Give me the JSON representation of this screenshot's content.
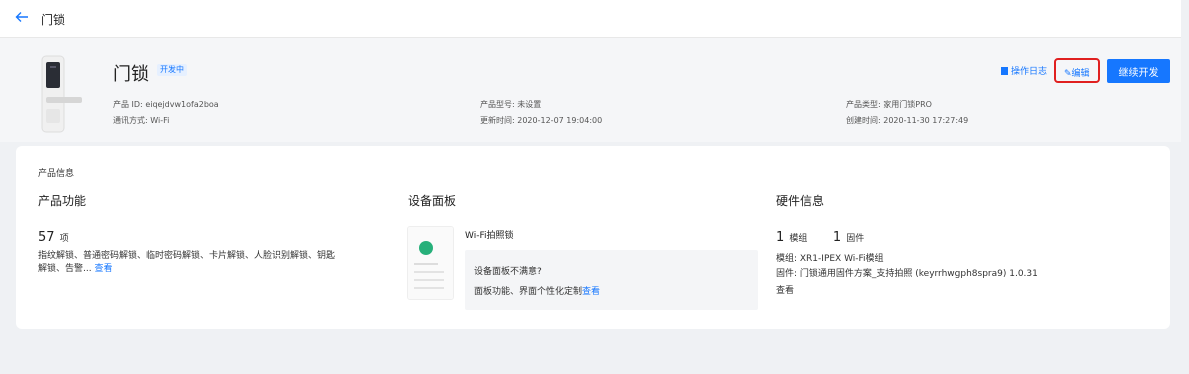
{
  "topbar": {
    "title": "门锁"
  },
  "product": {
    "name": "门锁",
    "status": "开发中",
    "id_label": "产品 ID:",
    "id_value": "eiqejdvw1ofa2boa",
    "comm_label": "通讯方式:",
    "comm_value": "Wi-Fi",
    "model_label": "产品型号:",
    "model_value": "未设置",
    "updated_label": "更新时间:",
    "updated_value": "2020-12-07 19:04:00",
    "type_label": "产品类型:",
    "type_value": "家用门锁PRO",
    "created_label": "创建时间:",
    "created_value": "2020-11-30 17:27:49"
  },
  "actions": {
    "log": "操作日志",
    "edit": "编辑",
    "continue": "继续开发"
  },
  "info": {
    "section_title": "产品信息",
    "functions": {
      "heading": "产品功能",
      "count": "57",
      "unit": "项",
      "desc_line1": "指纹解锁、普通密码解锁、临时密码解锁、卡片解锁、人脸识别解锁、钥匙",
      "desc_line2": "解锁、告警...",
      "view": "查看"
    },
    "panel": {
      "heading": "设备面板",
      "name": "Wi-Fi拍照锁",
      "question": "设备面板不满意?",
      "custom_text": "面板功能、界面个性化定制",
      "view": "查看"
    },
    "hardware": {
      "heading": "硬件信息",
      "module_count": "1",
      "module_unit": "模组",
      "firmware_count": "1",
      "firmware_unit": "固件",
      "module_line": "模组: XR1-IPEX Wi-Fi模组",
      "firmware_line": "固件: 门锁通用固件方案_支持拍照 (keyrrhwgph8spra9) 1.0.31",
      "view": "查看"
    }
  },
  "colors": {
    "accent": "#1677ff",
    "highlight": "#e02020"
  }
}
